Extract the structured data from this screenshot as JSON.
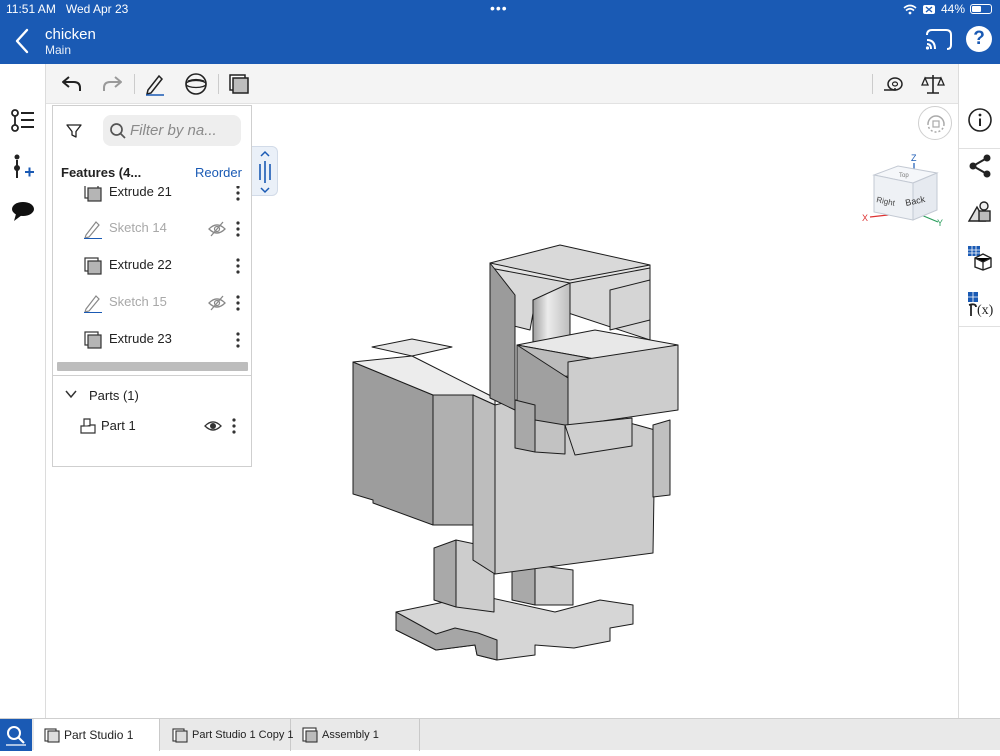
{
  "status_bar": {
    "time": "11:51 AM",
    "date": "Wed Apr 23",
    "battery_text": "44%",
    "battery_level": 0.44
  },
  "header": {
    "title": "chicken",
    "subtitle": "Main",
    "help_label": "?"
  },
  "feature_panel": {
    "search_placeholder": "Filter by na...",
    "features_title": "Features (4...",
    "reorder_label": "Reorder",
    "features": [
      {
        "label": "Extrude 21",
        "type": "extrude",
        "suppressed": false
      },
      {
        "label": "Sketch 14",
        "type": "sketch",
        "suppressed": true
      },
      {
        "label": "Extrude 22",
        "type": "extrude",
        "suppressed": false
      },
      {
        "label": "Sketch 15",
        "type": "sketch",
        "suppressed": true
      },
      {
        "label": "Extrude 23",
        "type": "extrude",
        "suppressed": false
      }
    ],
    "parts_title": "Parts (1)",
    "parts": [
      {
        "label": "Part 1"
      }
    ]
  },
  "view_cube": {
    "face_front": "Back",
    "face_side": "Right",
    "face_top": "Top",
    "axis_z": "Z",
    "axis_x": "X",
    "axis_y": "Y"
  },
  "bottom_tabs": [
    {
      "label": "Part Studio 1",
      "active": true
    },
    {
      "label": "Part Studio 1 Copy 1",
      "active": false
    },
    {
      "label": "Assembly 1",
      "active": false
    }
  ],
  "colors": {
    "brand_blue": "#1a5ab4",
    "model_face": "#c9c9c9"
  }
}
